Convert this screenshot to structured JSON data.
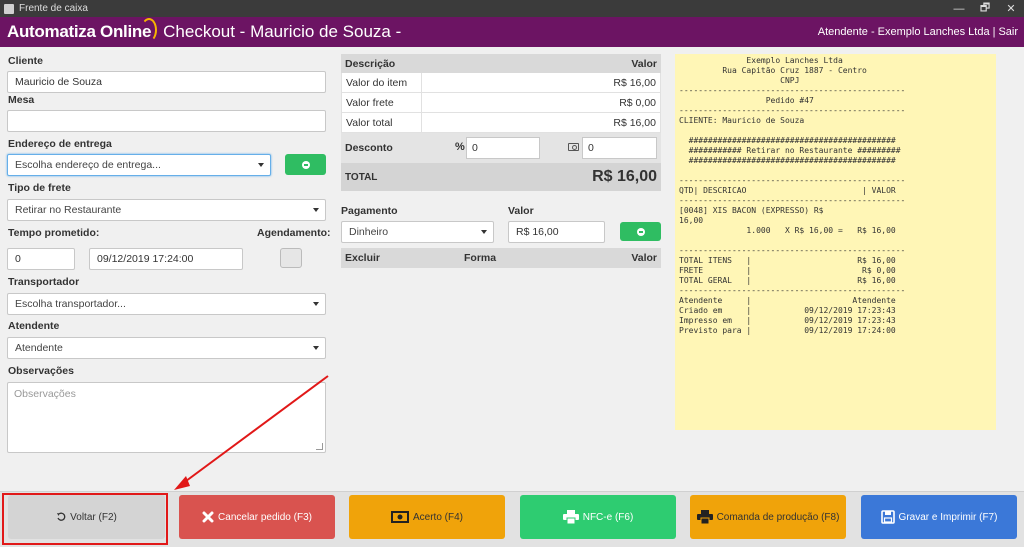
{
  "window": {
    "title": "Frente de caixa",
    "controls": [
      "—",
      "🗗",
      "✕"
    ]
  },
  "header": {
    "logo": "Automatiza Online",
    "title": "Checkout - Mauricio de Souza -",
    "user": "Atendente - Exemplo Lanches Ltda",
    "separator": "|",
    "logout": "Sair"
  },
  "form": {
    "cliente_label": "Cliente",
    "cliente_value": "Mauricio de Souza",
    "mesa_label": "Mesa",
    "mesa_value": "",
    "endereco_label": "Endereço de entrega",
    "endereco_value": "Escolha endereço de entrega...",
    "frete_label": "Tipo de frete",
    "frete_value": "Retirar no Restaurante",
    "tempo_label": "Tempo prometido:",
    "tempo_value": "0",
    "tempo_datetime": "09/12/2019 17:24:00",
    "agendamento_label": "Agendamento:",
    "transportador_label": "Transportador",
    "transportador_value": "Escolha transportador...",
    "atendente_label": "Atendente",
    "atendente_value": "Atendente",
    "observacoes_label": "Observações",
    "observacoes_placeholder": "Observações"
  },
  "summary": {
    "col_desc": "Descrição",
    "col_valor": "Valor",
    "rows": [
      {
        "label": "Valor do item",
        "value": "R$ 16,00"
      },
      {
        "label": "Valor frete",
        "value": "R$ 0,00"
      },
      {
        "label": "Valor total",
        "value": "R$ 16,00"
      }
    ],
    "desconto_label": "Desconto",
    "pct_symbol": "%",
    "desconto_pct": "0",
    "desconto_valor": "0",
    "total_label": "TOTAL",
    "total_value": "R$ 16,00"
  },
  "payment": {
    "pagamento_label": "Pagamento",
    "valor_label": "Valor",
    "pagamento_value": "Dinheiro",
    "valor_value": "R$ 16,00",
    "col_excluir": "Excluir",
    "col_forma": "Forma",
    "col_valor": "Valor"
  },
  "receipt": {
    "text": "              Exemplo Lanches Ltda\n         Rua Capitão Cruz 1887 - Centro\n                     CNPJ\n-----------------------------------------------\n                  Pedido #47\n-----------------------------------------------\nCLIENTE: Mauricio de Souza\n\n  ###########################################\n  ########### Retirar no Restaurante #########\n  ###########################################\n\n-----------------------------------------------\nQTD| DESCRICAO                        | VALOR\n-----------------------------------------------\n[0048] XIS BACON (EXPRESSO) R$\n16,00\n              1.000   X R$ 16,00 =   R$ 16,00\n\n-----------------------------------------------\nTOTAL ITENS   |                      R$ 16,00\nFRETE         |                       R$ 0,00\nTOTAL GERAL   |                      R$ 16,00\n-----------------------------------------------\nAtendente     |                     Atendente\nCriado em     |           09/12/2019 17:23:43\nImpresso em   |           09/12/2019 17:23:43\nPrevisto para |           09/12/2019 17:24:00"
  },
  "footer": {
    "voltar": "Voltar (F2)",
    "cancelar": "Cancelar pedido (F3)",
    "acerto": "Acerto (F4)",
    "nfce": "NFC-e (F6)",
    "comanda": "Comanda de produção (F8)",
    "gravar": "Gravar e Imprimir (F7)"
  },
  "colors": {
    "header_bg": "#6c1463",
    "logo_accent": "#f7b500",
    "green": "#2fbd62",
    "danger": "#d9534f",
    "warning": "#f0a30a",
    "success": "#2ecc71",
    "primary": "#3b78d8",
    "receipt_bg": "#fff6b6",
    "annotation_red": "#e11818"
  }
}
